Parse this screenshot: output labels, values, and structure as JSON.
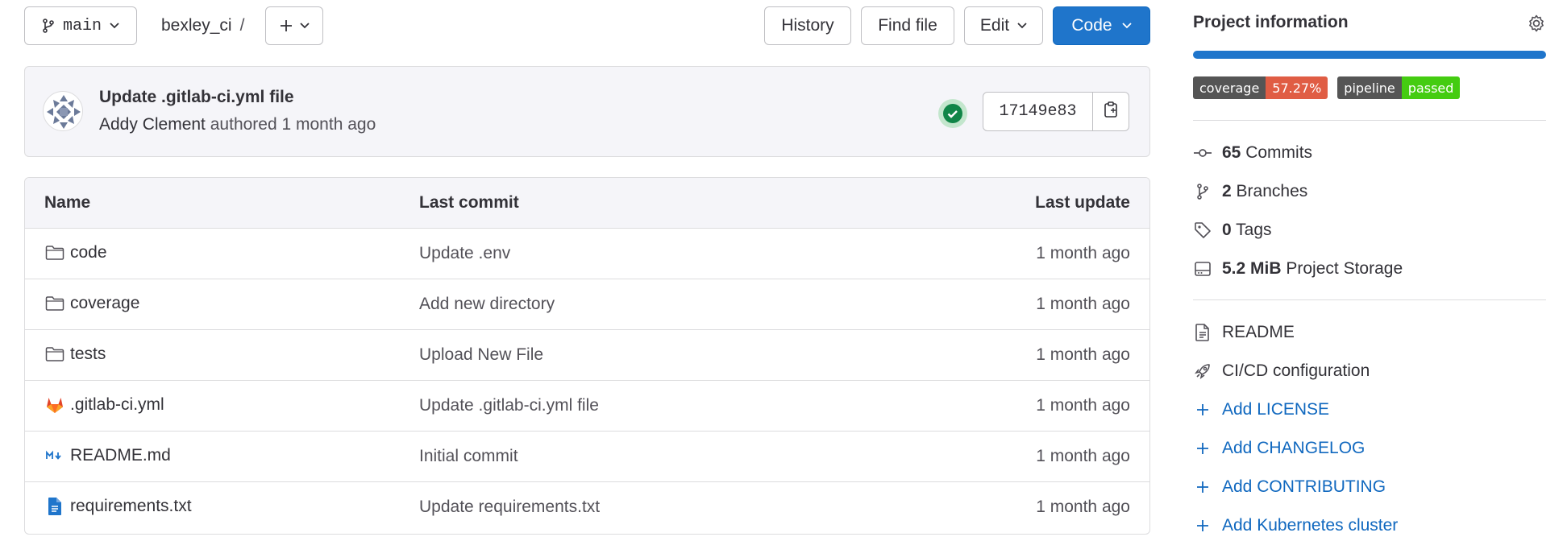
{
  "toolbar": {
    "branch": "main",
    "project": "bexley_ci",
    "separator": "/",
    "history": "History",
    "find_file": "Find file",
    "edit": "Edit",
    "code": "Code"
  },
  "commit": {
    "title": "Update .gitlab-ci.yml file",
    "author": "Addy Clement",
    "action": "authored",
    "when": "1 month ago",
    "sha": "17149e83",
    "status": "passed"
  },
  "table": {
    "headers": {
      "name": "Name",
      "last_commit": "Last commit",
      "last_update": "Last update"
    },
    "rows": [
      {
        "name": "code",
        "icon": "folder-icon",
        "commit": "Update .env",
        "updated": "1 month ago"
      },
      {
        "name": "coverage",
        "icon": "folder-icon",
        "commit": "Add new directory",
        "updated": "1 month ago"
      },
      {
        "name": "tests",
        "icon": "folder-icon",
        "commit": "Upload New File",
        "updated": "1 month ago"
      },
      {
        "name": ".gitlab-ci.yml",
        "icon": "gitlab-icon",
        "commit": "Update .gitlab-ci.yml file",
        "updated": "1 month ago"
      },
      {
        "name": "README.md",
        "icon": "markdown-icon",
        "commit": "Initial commit",
        "updated": "1 month ago"
      },
      {
        "name": "requirements.txt",
        "icon": "text-file-icon",
        "commit": "Update requirements.txt",
        "updated": "1 month ago"
      }
    ]
  },
  "sidebar": {
    "title": "Project information",
    "language_bar_fraction": 1.0,
    "badges": [
      {
        "key": "coverage",
        "value": "57.27%",
        "color": "#e05d44"
      },
      {
        "key": "pipeline",
        "value": "passed",
        "color": "#4c1"
      }
    ],
    "stats": [
      {
        "count": "65",
        "label": "Commits",
        "icon": "commit-icon"
      },
      {
        "count": "2",
        "label": "Branches",
        "icon": "branch-icon"
      },
      {
        "count": "0",
        "label": "Tags",
        "icon": "tag-icon"
      },
      {
        "count": "5.2 MiB",
        "label": "Project Storage",
        "icon": "storage-icon"
      }
    ],
    "links": [
      {
        "label": "README",
        "icon": "document-icon"
      },
      {
        "label": "CI/CD configuration",
        "icon": "rocket-icon"
      }
    ],
    "add_links": [
      {
        "label": "Add LICENSE"
      },
      {
        "label": "Add CHANGELOG"
      },
      {
        "label": "Add CONTRIBUTING"
      },
      {
        "label": "Add Kubernetes cluster"
      }
    ]
  },
  "colors": {
    "primary": "#1f75cb",
    "link": "#1068bf",
    "success": "#108548",
    "text": "#333238",
    "muted": "#535158"
  }
}
